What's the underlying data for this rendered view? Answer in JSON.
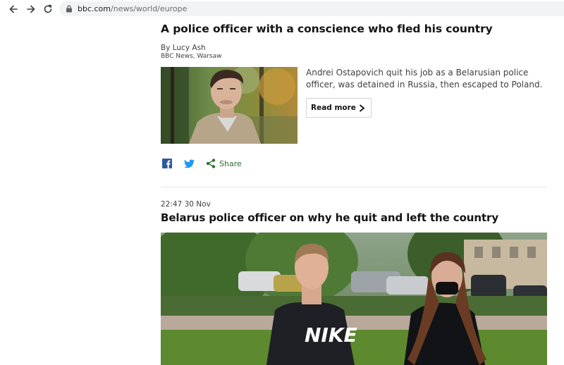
{
  "browser": {
    "url_domain": "bbc.com",
    "url_path": "/news/world/europe",
    "back_icon": "arrow-left-icon",
    "forward_icon": "arrow-right-icon",
    "reload_icon": "reload-icon",
    "lock_icon": "lock-icon"
  },
  "article1": {
    "title": "A police officer with a conscience who fled his country",
    "author": "By Lucy Ash",
    "org": "BBC News, Warsaw",
    "summary": "Andrei Ostapovich quit his job as a Belarusian police officer, was detained in Russia, then escaped to Poland.",
    "read_more": "Read more",
    "share_label": "Share"
  },
  "article2": {
    "timestamp": "22:47 30 Nov",
    "title": "Belarus police officer on why he quit and left the country",
    "sweatshirt_logo": "NIKE"
  },
  "colors": {
    "share_green": "#2f6e2f",
    "facebook_blue": "#2d5b9a",
    "twitter_blue": "#1d9bf0"
  }
}
